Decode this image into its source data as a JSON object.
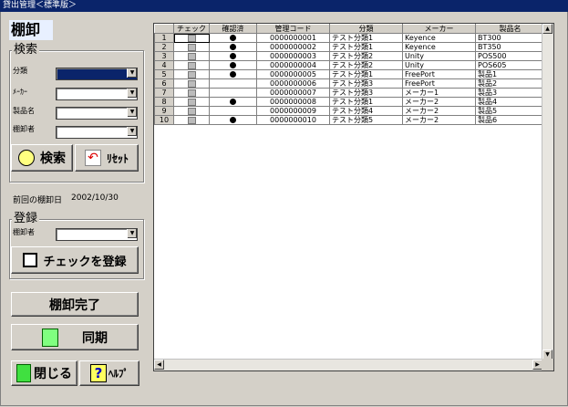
{
  "window": {
    "title": "貸出管理＜標準版＞"
  },
  "page_title": "棚卸",
  "search": {
    "group_label": "検索",
    "labels": {
      "category": "分類",
      "maker": "ﾒｰｶｰ",
      "product": "製品名",
      "user": "棚卸者"
    },
    "values": {
      "category": "",
      "maker": "",
      "product": "",
      "user": ""
    },
    "search_button": "検索",
    "reset_button": "ﾘｾｯﾄ"
  },
  "last_inventory": {
    "label": "前回の棚卸日",
    "date": "2002/10/30"
  },
  "register": {
    "group_label": "登録",
    "user_label": "棚卸者",
    "user_value": "",
    "register_button": "チェックを登録"
  },
  "buttons": {
    "complete": "棚卸完了",
    "sync": "同期",
    "close": "閉じる",
    "help": "ﾍﾙﾌﾟ"
  },
  "grid": {
    "columns": [
      "チェック",
      "確認済",
      "管理コード",
      "分類",
      "メーカー",
      "製品名"
    ],
    "rows": [
      {
        "n": "1",
        "check": false,
        "confirmed": true,
        "code": "0000000001",
        "category": "テスト分類1",
        "maker": "Keyence",
        "product": "BT300"
      },
      {
        "n": "2",
        "check": false,
        "confirmed": true,
        "code": "0000000002",
        "category": "テスト分類1",
        "maker": "Keyence",
        "product": "BT350"
      },
      {
        "n": "3",
        "check": false,
        "confirmed": true,
        "code": "0000000003",
        "category": "テスト分類2",
        "maker": "Unity",
        "product": "POS500"
      },
      {
        "n": "4",
        "check": false,
        "confirmed": true,
        "code": "0000000004",
        "category": "テスト分類2",
        "maker": "Unity",
        "product": "POS605"
      },
      {
        "n": "5",
        "check": false,
        "confirmed": true,
        "code": "0000000005",
        "category": "テスト分類1",
        "maker": "FreePort",
        "product": "製品1"
      },
      {
        "n": "6",
        "check": false,
        "confirmed": false,
        "code": "0000000006",
        "category": "テスト分類3",
        "maker": "FreePort",
        "product": "製品2"
      },
      {
        "n": "7",
        "check": false,
        "confirmed": false,
        "code": "0000000007",
        "category": "テスト分類3",
        "maker": "メーカー1",
        "product": "製品3"
      },
      {
        "n": "8",
        "check": false,
        "confirmed": true,
        "code": "0000000008",
        "category": "テスト分類1",
        "maker": "メーカー2",
        "product": "製品4"
      },
      {
        "n": "9",
        "check": false,
        "confirmed": false,
        "code": "0000000009",
        "category": "テスト分類4",
        "maker": "メーカー2",
        "product": "製品5"
      },
      {
        "n": "10",
        "check": false,
        "confirmed": true,
        "code": "0000000010",
        "category": "テスト分類5",
        "maker": "メーカー2",
        "product": "製品6"
      }
    ]
  },
  "colors": {
    "titlebar": "#0a246a",
    "face": "#d4d0c8",
    "selected_field": "#0a246a"
  }
}
